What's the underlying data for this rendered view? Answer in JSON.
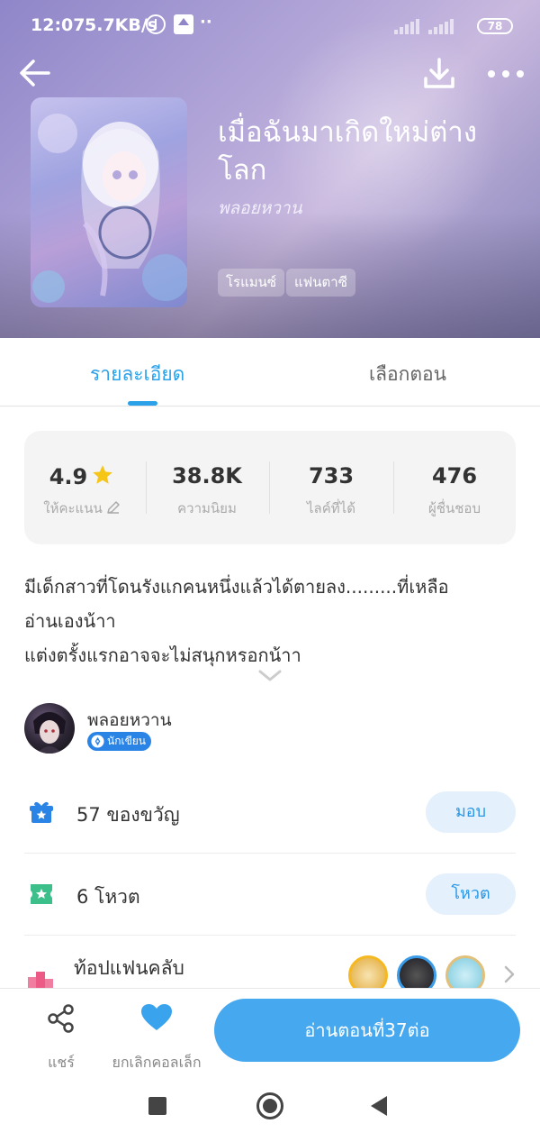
{
  "status_bar": {
    "time": "12:07",
    "speed": "5.7KB/s",
    "dots": "··",
    "battery": "78"
  },
  "novel": {
    "title": "เมื่อฉันมาเกิดใหม่ต่างโลก",
    "author": "พลอยหวาน",
    "tags": [
      "โรแมนซ์",
      "แฟนตาซี"
    ]
  },
  "tabs": {
    "details": "รายละเอียด",
    "episodes": "เลือกตอน"
  },
  "stats": [
    {
      "value": "4.9",
      "label": "ให้คะแนน"
    },
    {
      "value": "38.8K",
      "label": "ความนิยม"
    },
    {
      "value": "733",
      "label": "ไลค์ที่ได้"
    },
    {
      "value": "476",
      "label": "ผู้ชื่นชอบ"
    }
  ],
  "description": [
    "มีเด็กสาวที่โดนรังแกคนหนึ่งแล้วได้ตายลง.........ที่เหลือ",
    "อ่านเองน้าา",
    "แต่งตรั้งแรกอาจจะไม่สนุกหรอกน้าา"
  ],
  "writer": {
    "name": "พลอยหวาน",
    "badge": "นักเขียน"
  },
  "gift": {
    "count_text": "57 ของขวัญ",
    "button": "มอบ"
  },
  "vote": {
    "count_text": "6 โหวต",
    "button": "โหวต"
  },
  "fanclub": {
    "title": "ท้อปแฟนคลับ"
  },
  "bottom": {
    "share": "แชร์",
    "uncollect": "ยกเลิกคอลเล็ก",
    "read": "อ่านตอนที่37ต่อ"
  },
  "colors": {
    "accent": "#2aa1e8",
    "read_button": "#46a8ef",
    "gift_icon": "#2a84e6",
    "vote_icon": "#3cbf8a",
    "heart": "#3aa3ee",
    "star": "#f5c518"
  },
  "icons": {
    "back": "arrow-left-icon",
    "download": "download-icon",
    "more": "more-dots-icon",
    "star": "star-icon",
    "pencil": "pencil-icon",
    "expand": "chevron-down-icon",
    "gift": "gift-icon",
    "vote": "ticket-icon",
    "fanclub": "podium-icon",
    "share": "share-icon",
    "collect": "heart-icon"
  }
}
